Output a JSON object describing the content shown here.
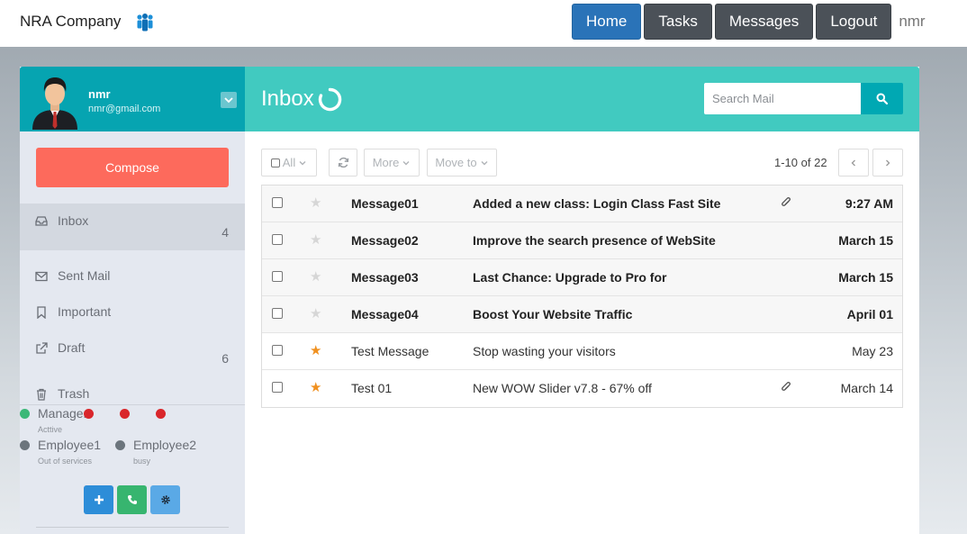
{
  "topbar": {
    "brand": "NRA Company",
    "brand_icon": "team-icon",
    "nav": [
      {
        "label": "Home",
        "active": true
      },
      {
        "label": "Tasks",
        "active": false
      },
      {
        "label": "Messages",
        "active": false
      },
      {
        "label": "Logout",
        "active": false
      }
    ],
    "user": "nmr"
  },
  "profile": {
    "name": "nmr",
    "email": "nmr@gmail.com"
  },
  "sidebar": {
    "compose_label": "Compose",
    "folders": [
      {
        "label": "Inbox",
        "count": "4",
        "icon": "inbox-icon"
      },
      {
        "label": "Sent Mail",
        "count": "",
        "icon": "envelope-icon"
      },
      {
        "label": "Important",
        "count": "",
        "icon": "bookmark-icon"
      },
      {
        "label": "Draft",
        "count": "6",
        "icon": "external-link-icon"
      },
      {
        "label": "Trash",
        "count": "",
        "icon": "trash-icon"
      }
    ],
    "contacts": [
      {
        "name": "Manager",
        "status": "Acttive",
        "color": "#3cb878"
      },
      {
        "name": "Employee1",
        "status": "Out of services",
        "color": "#6c757d"
      },
      {
        "name": "Employee2",
        "status": "busy",
        "color": "#6c757d"
      }
    ],
    "extra_dot_color": "#d9262b"
  },
  "main": {
    "title": "Inbox",
    "search_placeholder": "Search Mail",
    "toolbar": {
      "all_label": "All",
      "more_label": "More",
      "move_label": "Move to"
    },
    "pagination": "1-10 of 22",
    "messages": [
      {
        "sender": "Message01",
        "subject": "Added a new class: Login Class Fast Site",
        "date": "9:27 AM",
        "starred": false,
        "attachment": true,
        "unread": true
      },
      {
        "sender": "Message02",
        "subject": "Improve the search presence of WebSite",
        "date": "March 15",
        "starred": false,
        "attachment": false,
        "unread": true
      },
      {
        "sender": "Message03",
        "subject": "Last Chance: Upgrade to Pro for",
        "date": "March 15",
        "starred": false,
        "attachment": false,
        "unread": true
      },
      {
        "sender": "Message04",
        "subject": "Boost Your Website Traffic",
        "date": "April 01",
        "starred": false,
        "attachment": false,
        "unread": true
      },
      {
        "sender": "Test Message",
        "subject": "Stop wasting your visitors",
        "date": "May 23",
        "starred": true,
        "attachment": false,
        "unread": false
      },
      {
        "sender": "Test 01",
        "subject": "New WOW Slider v7.8 - 67% off",
        "date": "March 14",
        "starred": true,
        "attachment": true,
        "unread": false
      }
    ]
  },
  "colors": {
    "accent_teal": "#41cac0",
    "profile_teal": "#06a4b1",
    "compose": "#fd6a5c",
    "home_blue": "#2a73b8",
    "star_orange": "#f0901f"
  }
}
